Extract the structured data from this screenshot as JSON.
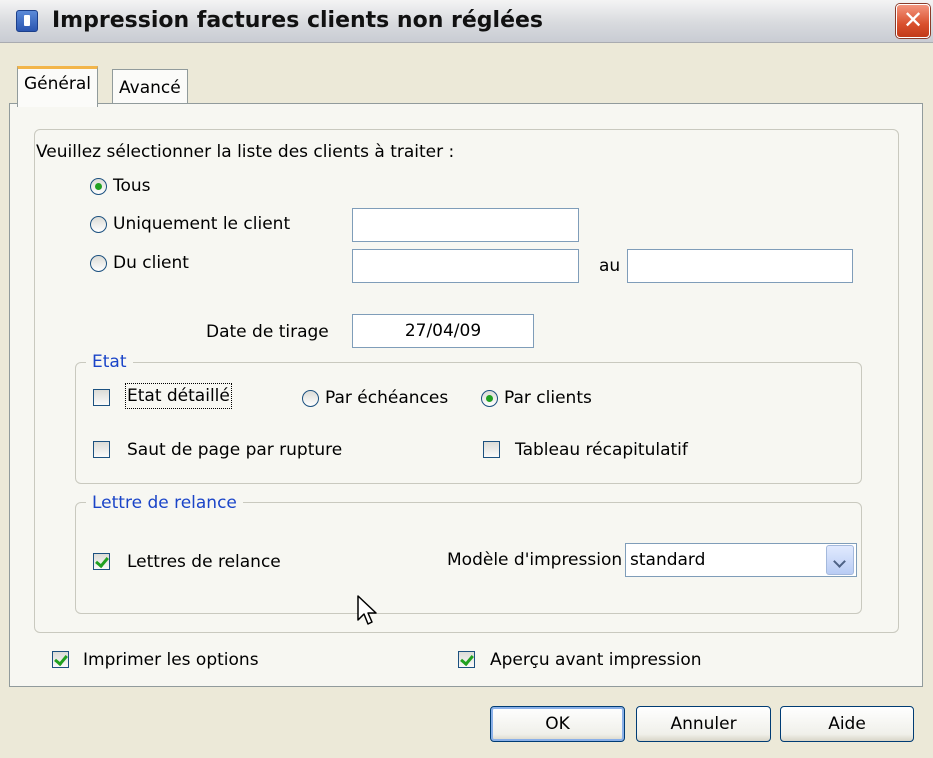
{
  "window": {
    "title": "Impression factures clients non réglées",
    "close_glyph": "✕"
  },
  "tabs": [
    {
      "label": "Général",
      "active": true
    },
    {
      "label": "Avancé",
      "active": false
    }
  ],
  "general": {
    "prompt": "Veuillez sélectionner la liste des clients à traiter :",
    "radios": [
      {
        "label": "Tous",
        "checked": true
      },
      {
        "label": "Uniquement le client",
        "checked": false
      },
      {
        "label": "Du client",
        "checked": false
      }
    ],
    "client_input_value": "",
    "from_client_value": "",
    "to_label": "au",
    "to_client_value": "",
    "date_label": "Date de tirage",
    "date_value": "27/04/09"
  },
  "etat": {
    "title": "Etat",
    "detailed_label": "Etat détaillé",
    "detailed_checked": false,
    "by_due_label": "Par échéances",
    "by_due_checked": false,
    "by_client_label": "Par clients",
    "by_client_checked": true,
    "page_break_label": "Saut de page par rupture",
    "page_break_checked": false,
    "summary_label": "Tableau récapitulatif",
    "summary_checked": false
  },
  "relance": {
    "title": "Lettre de relance",
    "letters_label": "Lettres de relance",
    "letters_checked": true,
    "model_label": "Modèle d'impression",
    "model_value": "standard"
  },
  "footer": {
    "print_options_label": "Imprimer les options",
    "print_options_checked": true,
    "preview_label": "Aperçu avant impression",
    "preview_checked": true
  },
  "buttons": {
    "ok": "OK",
    "cancel": "Annuler",
    "help": "Aide"
  },
  "colors": {
    "group_title": "#1a44c8",
    "check_mark": "#21a121",
    "close": "#d9502d"
  }
}
